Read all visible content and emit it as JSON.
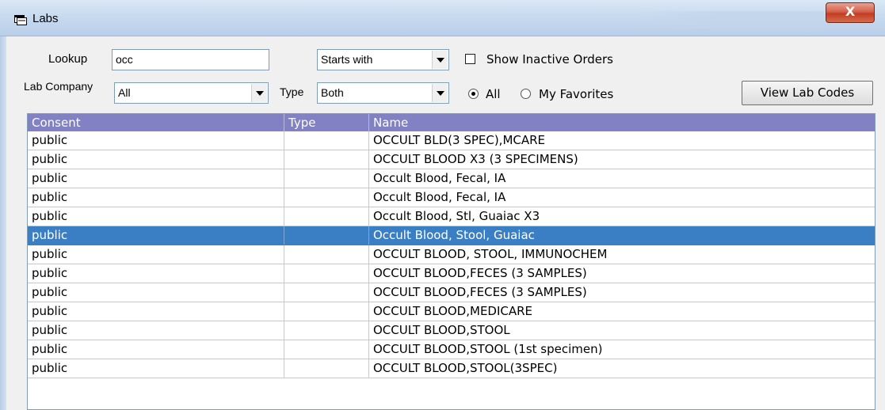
{
  "window": {
    "title": "Labs",
    "close_glyph": "X"
  },
  "filters": {
    "lookup_label": "Lookup",
    "lookup_value": "occ",
    "match_mode": "Starts with",
    "show_inactive_label": "Show Inactive Orders",
    "show_inactive_checked": false,
    "lab_company_label": "Lab Company",
    "lab_company_value": "All",
    "type_label": "Type",
    "type_value": "Both",
    "scope_options": [
      {
        "label": "All",
        "selected": true
      },
      {
        "label": "My Favorites",
        "selected": false
      }
    ],
    "view_codes_label": "View Lab Codes"
  },
  "table": {
    "columns": [
      "Consent",
      "Type",
      "Name"
    ],
    "selected_index": 5,
    "rows": [
      {
        "consent": "public",
        "type": "",
        "name": "OCCULT BLD(3 SPEC),MCARE"
      },
      {
        "consent": "public",
        "type": "",
        "name": "OCCULT BLOOD X3 (3 SPECIMENS)"
      },
      {
        "consent": "public",
        "type": "",
        "name": "Occult Blood, Fecal, IA"
      },
      {
        "consent": "public",
        "type": "",
        "name": "Occult Blood, Fecal, IA"
      },
      {
        "consent": "public",
        "type": "",
        "name": "Occult Blood, Stl, Guaiac X3"
      },
      {
        "consent": "public",
        "type": "",
        "name": "Occult Blood, Stool, Guaiac"
      },
      {
        "consent": "public",
        "type": "",
        "name": "OCCULT BLOOD, STOOL, IMMUNOCHEM"
      },
      {
        "consent": "public",
        "type": "",
        "name": "OCCULT BLOOD,FECES (3 SAMPLES)"
      },
      {
        "consent": "public",
        "type": "",
        "name": "OCCULT BLOOD,FECES (3 SAMPLES)"
      },
      {
        "consent": "public",
        "type": "",
        "name": "OCCULT BLOOD,MEDICARE"
      },
      {
        "consent": "public",
        "type": "",
        "name": "OCCULT BLOOD,STOOL"
      },
      {
        "consent": "public",
        "type": "",
        "name": "OCCULT BLOOD,STOOL (1st specimen)"
      },
      {
        "consent": "public",
        "type": "",
        "name": "OCCULT BLOOD,STOOL(3SPEC)"
      }
    ]
  }
}
